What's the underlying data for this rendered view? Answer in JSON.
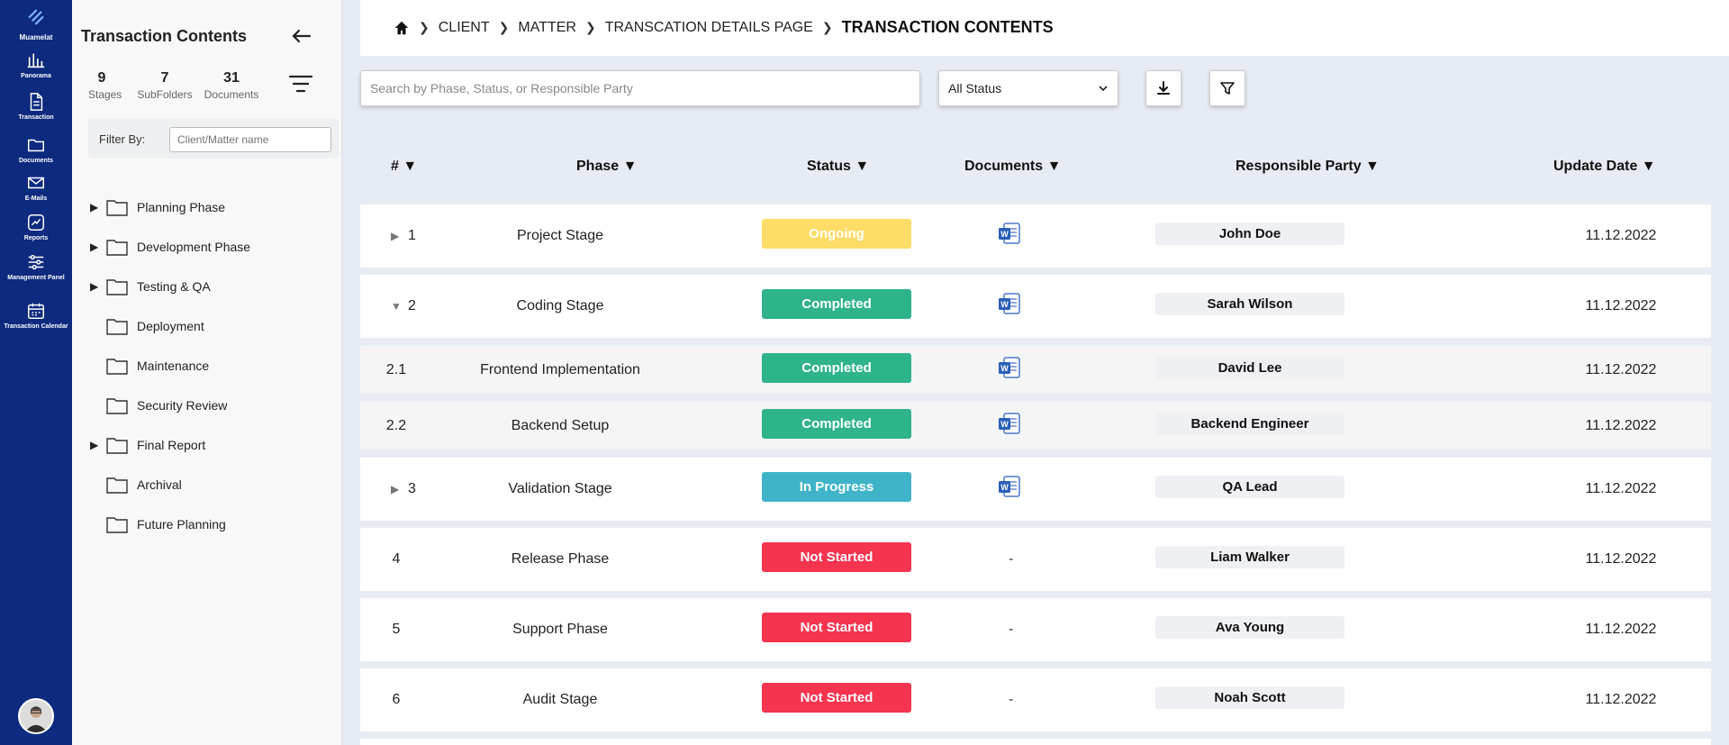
{
  "rail": {
    "brand": "Muamelat",
    "items": [
      {
        "label": "Panorama",
        "icon": "bar-chart-icon"
      },
      {
        "label": "Transaction",
        "icon": "document-icon"
      },
      {
        "label": "Documents",
        "icon": "folder-icon"
      },
      {
        "label": "E-Mails",
        "icon": "mail-icon"
      },
      {
        "label": "Reports",
        "icon": "report-icon"
      },
      {
        "label": "Management Panel",
        "icon": "sliders-icon"
      },
      {
        "label": "Transaction Calendar",
        "icon": "calendar-icon"
      }
    ]
  },
  "panel": {
    "title": "Transaction Contents",
    "stats": [
      {
        "num": "9",
        "cap": "Stages"
      },
      {
        "num": "7",
        "cap": "SubFolders"
      },
      {
        "num": "31",
        "cap": "Documents"
      }
    ],
    "filter_label": "Filter By:",
    "filter_placeholder": "Client/Matter name",
    "tree": [
      {
        "label": "Planning Phase",
        "expandable": true
      },
      {
        "label": "Development Phase",
        "expandable": true
      },
      {
        "label": "Testing & QA",
        "expandable": true
      },
      {
        "label": "Deployment",
        "expandable": false
      },
      {
        "label": "Maintenance",
        "expandable": false
      },
      {
        "label": "Security Review",
        "expandable": false
      },
      {
        "label": "Final Report",
        "expandable": true
      },
      {
        "label": "Archival",
        "expandable": false
      },
      {
        "label": "Future Planning",
        "expandable": false
      }
    ]
  },
  "breadcrumb": {
    "items": [
      "CLIENT",
      "MATTER",
      "TRANSCATION DETAILS PAGE"
    ],
    "current": "TRANSACTION CONTENTS"
  },
  "toolbar": {
    "search_placeholder": "Search by Phase, Status, or Responsible Party",
    "status_value": "All Status"
  },
  "table": {
    "headers": [
      "# ▼",
      "Phase ▼",
      "Status ▼",
      "Documents ▼",
      "Responsible Party ▼",
      "Update Date ▼"
    ],
    "rows": [
      {
        "num": "1",
        "caret": "▶",
        "phase": "Project Stage",
        "status": "Ongoing",
        "has_doc": true,
        "party": "John Doe",
        "date": "11.12.2022"
      },
      {
        "num": "2",
        "caret": "▼",
        "phase": "Coding Stage",
        "status": "Completed",
        "has_doc": true,
        "party": "Sarah Wilson",
        "date": "11.12.2022"
      },
      {
        "num": "2.1",
        "caret": "",
        "phase": "Frontend Implementation",
        "status": "Completed",
        "has_doc": true,
        "party": "David Lee",
        "date": "11.12.2022"
      },
      {
        "num": "2.2",
        "caret": "",
        "phase": "Backend Setup",
        "status": "Completed",
        "has_doc": true,
        "party": "Backend Engineer",
        "date": "11.12.2022"
      },
      {
        "num": "3",
        "caret": "▶",
        "phase": "Validation Stage",
        "status": "In Progress",
        "has_doc": true,
        "party": "QA Lead",
        "date": "11.12.2022"
      },
      {
        "num": "4",
        "caret": "",
        "phase": "Release Phase",
        "status": "Not Started",
        "has_doc": false,
        "doc_text": "-",
        "party": "Liam Walker",
        "date": "11.12.2022"
      },
      {
        "num": "5",
        "caret": "",
        "phase": "Support Phase",
        "status": "Not Started",
        "has_doc": false,
        "doc_text": "-",
        "party": "Ava Young",
        "date": "11.12.2022"
      },
      {
        "num": "6",
        "caret": "",
        "phase": "Audit Stage",
        "status": "Not Started",
        "has_doc": false,
        "doc_text": "-",
        "party": "Noah Scott",
        "date": "11.12.2022"
      }
    ]
  },
  "colors": {
    "rail": "#0d2a7f",
    "ongoing": "#fddc67",
    "completed": "#2fb38a",
    "in_progress": "#3fb4c9",
    "not_started": "#f5344f"
  }
}
